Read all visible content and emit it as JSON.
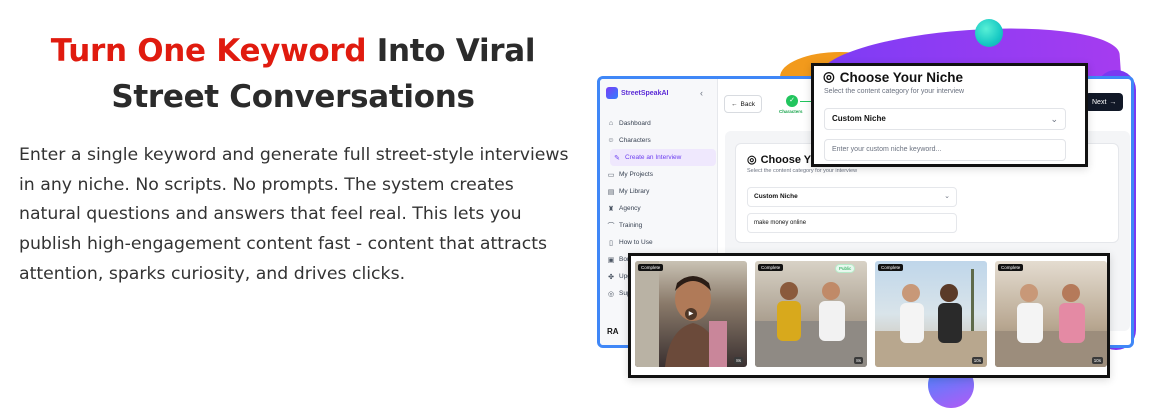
{
  "headline": {
    "accent": "Turn One Keyword",
    "rest_line1": " Into Viral",
    "line2": "Street Conversations"
  },
  "description": "Enter a single keyword and generate full street-style interviews in any niche. No scripts. No prompts. The system creates natural questions and answers that feel real. This lets you publish high-engagement content fast - content that attracts attention, sparks curiosity, and drives clicks.",
  "app": {
    "brand": "StreetSpeakAI",
    "collapse_glyph": "‹",
    "nav": [
      {
        "label": "Dashboard",
        "icon": "home-icon"
      },
      {
        "label": "Characters",
        "icon": "characters-icon"
      },
      {
        "label": "Create an Interview",
        "icon": "pen-icon"
      },
      {
        "label": "My Projects",
        "icon": "folder-icon"
      },
      {
        "label": "My Library",
        "icon": "library-icon"
      },
      {
        "label": "Agency",
        "icon": "agency-icon"
      },
      {
        "label": "Training",
        "icon": "training-icon"
      },
      {
        "label": "How to Use",
        "icon": "book-icon"
      },
      {
        "label": "Bon",
        "icon": "gift-icon"
      },
      {
        "label": "Upg",
        "icon": "upgrade-icon"
      },
      {
        "label": "Sup",
        "icon": "support-icon"
      }
    ],
    "user_initials": "RA",
    "back_label": "Back",
    "step_check": "✓",
    "step_label": "Characters",
    "next_label": "Next",
    "card": {
      "title": "Choose Y",
      "subtitle": "Select the content category for your interview",
      "select_value": "Custom Niche",
      "input_value": "make money online"
    }
  },
  "popup": {
    "title": "Choose Your Niche",
    "subtitle": "Select the content category for your interview",
    "select_value": "Custom Niche",
    "input_placeholder": "Enter your custom niche keyword..."
  },
  "thumbnails": [
    {
      "badge": "Complete",
      "public": "",
      "duration": "8s"
    },
    {
      "badge": "Complete",
      "public": "Public",
      "duration": "8s"
    },
    {
      "badge": "Complete",
      "public": "",
      "duration": "10s"
    },
    {
      "badge": "Complete",
      "public": "",
      "duration": "10s"
    }
  ],
  "colors": {
    "accent_red": "#e01b0f",
    "brand_purple": "#6d3ff0",
    "window_border": "#3f87f7",
    "success_green": "#22c55e"
  }
}
